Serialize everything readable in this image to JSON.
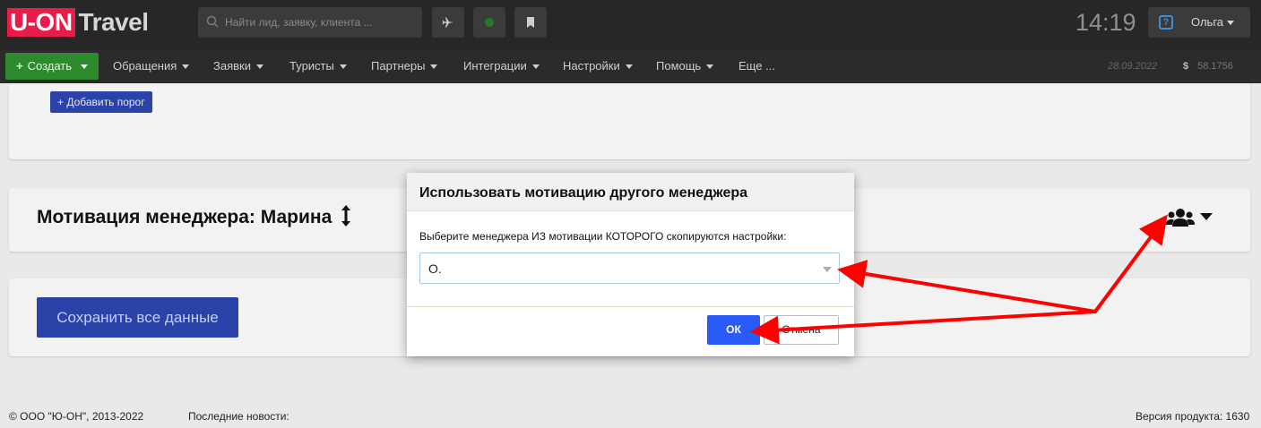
{
  "header": {
    "logo_brand": "U-ON",
    "logo_sub": "Travel",
    "search_placeholder": "Найти лид, заявку, клиента ...",
    "clock": "14:19",
    "user_name": "Ольга",
    "help_glyph": "?"
  },
  "nav": {
    "create_label": "Создать",
    "items": [
      {
        "label": "Обращения"
      },
      {
        "label": "Заявки"
      },
      {
        "label": "Туристы"
      },
      {
        "label": "Партнеры"
      },
      {
        "label": "Интеграции"
      },
      {
        "label": "Настройки"
      },
      {
        "label": "Помощь"
      },
      {
        "label": "Еще ..."
      }
    ],
    "date": "28.09.2022",
    "currency_symbol": "$",
    "rate": "58.1756"
  },
  "page": {
    "add_threshold_label": "Добавить порог",
    "motivation_title": "Мотивация менеджера: Марина",
    "save_all_label": "Сохранить все данные"
  },
  "modal": {
    "title": "Использовать мотивацию другого менеджера",
    "label": "Выберите менеджера ИЗ мотивации КОТОРОГО скопируются настройки:",
    "selected_value": "О.",
    "ok_label": "ОК",
    "cancel_label": "Отмена"
  },
  "footer": {
    "copyright": "© ООО \"Ю-ОН\", 2013-2022",
    "news": "Последние новости:",
    "version": "Версия продукта: 1630"
  },
  "colors": {
    "annotation_arrow": "#ff0000",
    "primary_button": "#2a5bf6",
    "create_button": "#2d8a2d"
  },
  "icons": [
    "search-icon",
    "plane-icon",
    "status-dot-icon",
    "bookmark-icon",
    "help-icon",
    "users-group-icon",
    "sort-vertical-icon"
  ]
}
